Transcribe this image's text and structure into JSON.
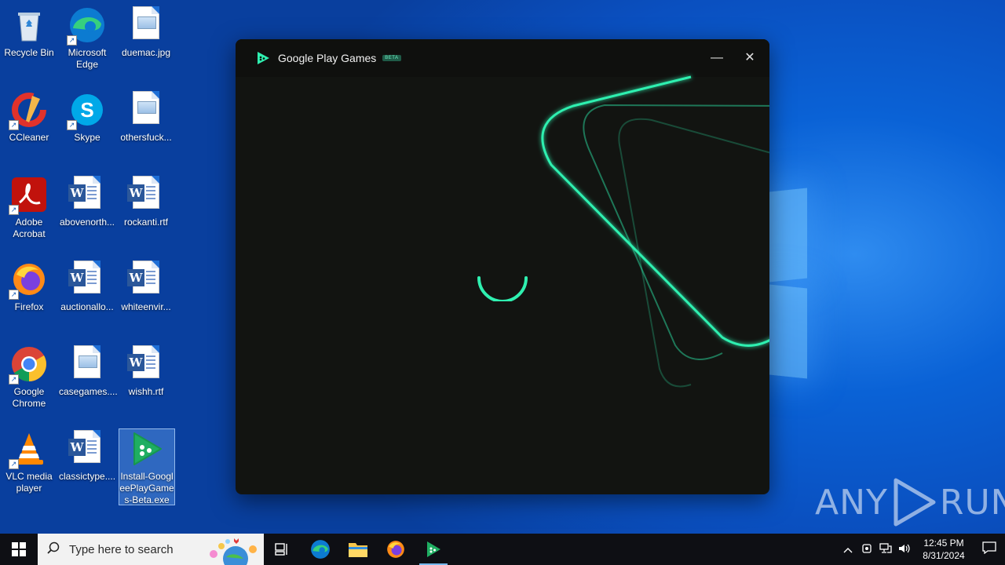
{
  "desktop": {
    "icons": [
      {
        "label": "Recycle Bin",
        "icon": "recycle-bin-icon"
      },
      {
        "label": "Microsoft Edge",
        "icon": "edge-icon"
      },
      {
        "label": "duemac.jpg",
        "icon": "image-file-icon"
      },
      {
        "label": "CCleaner",
        "icon": "ccleaner-icon"
      },
      {
        "label": "Skype",
        "icon": "skype-icon"
      },
      {
        "label": "othersfuck...",
        "icon": "image-file-icon"
      },
      {
        "label": "Adobe Acrobat",
        "icon": "acrobat-icon"
      },
      {
        "label": "abovenorth...",
        "icon": "word-doc-icon"
      },
      {
        "label": "rockanti.rtf",
        "icon": "word-doc-icon"
      },
      {
        "label": "Firefox",
        "icon": "firefox-icon"
      },
      {
        "label": "auctionallo...",
        "icon": "word-doc-icon"
      },
      {
        "label": "whiteenvir...",
        "icon": "word-doc-icon"
      },
      {
        "label": "Google Chrome",
        "icon": "chrome-icon"
      },
      {
        "label": "casegames....",
        "icon": "image-file-icon"
      },
      {
        "label": "wishh.rtf",
        "icon": "word-doc-icon"
      },
      {
        "label": "VLC media player",
        "icon": "vlc-icon"
      },
      {
        "label": "classictype....",
        "icon": "word-doc-icon"
      },
      {
        "label": "Install-GoogleePlayGames-Beta.exe",
        "icon": "google-play-games-icon"
      }
    ]
  },
  "app_window": {
    "title": "Google Play Games",
    "badge": "BETA",
    "minimize_label": "—",
    "close_label": "✕",
    "state": "loading"
  },
  "watermark": {
    "left": "ANY",
    "right": "RUN"
  },
  "taskbar": {
    "search_placeholder": "Type here to search",
    "pinned": [
      "task-view",
      "edge",
      "file-explorer",
      "firefox",
      "google-play-games"
    ],
    "active": "google-play-games",
    "time": "12:45 PM",
    "date": "8/31/2024"
  },
  "colors": {
    "accent_green": "#2ff0b0",
    "window_bg": "#121411",
    "taskbar_bg": "#0e0f14"
  }
}
